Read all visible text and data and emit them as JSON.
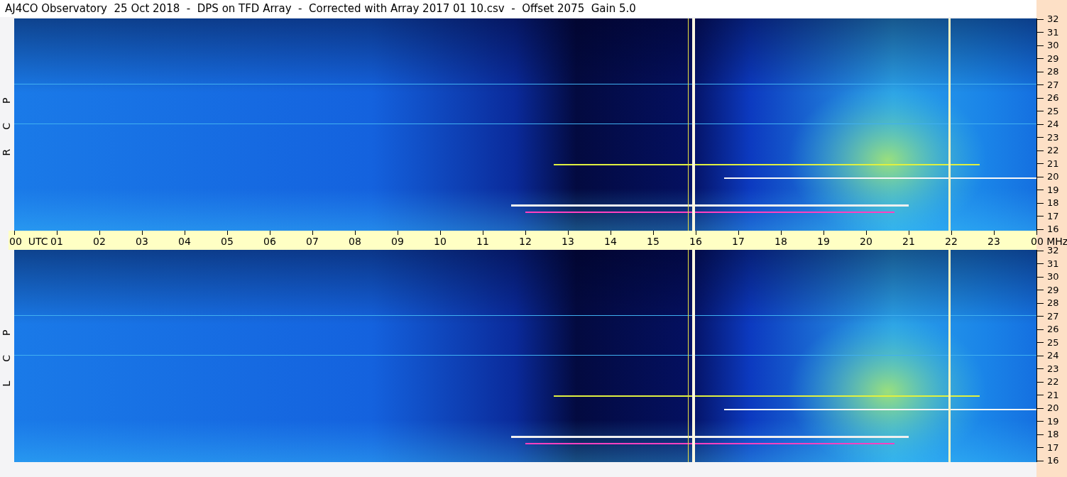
{
  "title": "AJ4CO Observatory  25 Oct 2018  -  DPS on TFD Array  -  Corrected with Array 2017 01 10.csv  -  Offset 2075  Gain 5.0",
  "panels": [
    {
      "label": "R  C  P",
      "freq_labels": [
        "32",
        "31",
        "30",
        "29",
        "28",
        "27",
        "26",
        "25",
        "24",
        "23",
        "22",
        "21",
        "20",
        "19",
        "18",
        "17",
        "16"
      ]
    },
    {
      "label": "L  C  P",
      "freq_labels": [
        "32",
        "31",
        "30",
        "29",
        "28",
        "27",
        "26",
        "25",
        "24",
        "23",
        "22",
        "21",
        "20",
        "19",
        "18",
        "17",
        "16"
      ]
    }
  ],
  "time_axis": [
    "00  UTC",
    "01",
    "02",
    "03",
    "04",
    "05",
    "06",
    "07",
    "08",
    "09",
    "10",
    "11",
    "12",
    "13",
    "14",
    "15",
    "16",
    "17",
    "18",
    "19",
    "20",
    "21",
    "22",
    "23",
    "00 MHz"
  ]
}
